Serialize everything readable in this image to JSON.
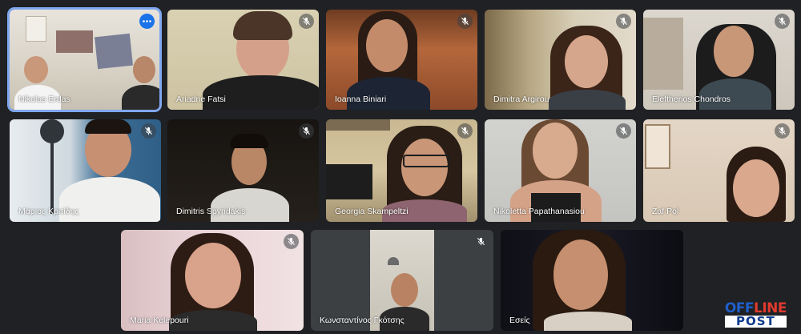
{
  "participants": [
    {
      "name": "Nikolas Erdas",
      "muted": false,
      "active": true
    },
    {
      "name": "Ariadne Fatsi",
      "muted": true
    },
    {
      "name": "Ioanna Biniari",
      "muted": true
    },
    {
      "name": "Dimitra Argirou",
      "muted": true
    },
    {
      "name": "Eleftherios Chondros",
      "muted": true
    },
    {
      "name": "Μάριος Κριτίδης",
      "muted": true
    },
    {
      "name": "Dimitris Spyridakis",
      "muted": true
    },
    {
      "name": "Georgia Skampeltzi",
      "muted": true
    },
    {
      "name": "Nikoletta Papathanasiou",
      "muted": true
    },
    {
      "name": "Zaf Pol",
      "muted": true
    },
    {
      "name": "Maria Kelepouri",
      "muted": true
    },
    {
      "name": "Κωνσταντίνος Γκότσης",
      "muted": true
    },
    {
      "name": "Εσείς",
      "muted": false
    }
  ],
  "icons": {
    "mute": "mic-off-icon",
    "options": "more-options-icon"
  },
  "colors": {
    "background": "#202124",
    "active_border": "#7fa7f0",
    "options_button": "#1a73e8"
  },
  "watermark": {
    "top_off": "OFF",
    "top_line": "LINE",
    "bottom": "POST"
  }
}
